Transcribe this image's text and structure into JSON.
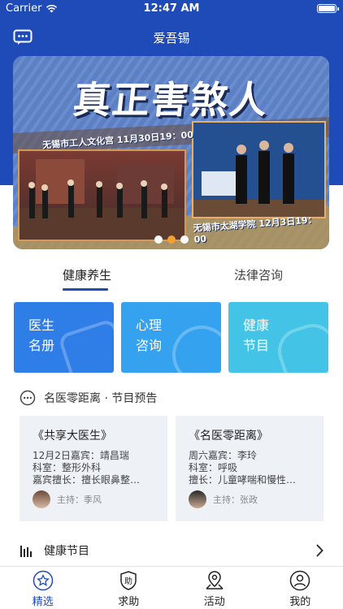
{
  "status_bar": {
    "carrier": "Carrier",
    "time": "12:47 AM"
  },
  "nav": {
    "title": "爱吾锡",
    "message_icon": "chat-bubble-icon"
  },
  "banner": {
    "title": "真正害煞人",
    "caption_1": "无锡市工人文化宫 11月30日19：00",
    "caption_2": "无锡市太湖学院 12月3日19：00",
    "page_count": 3,
    "active_page": 2
  },
  "tabs": [
    {
      "label": "健康养生",
      "active": true
    },
    {
      "label": "法律咨询",
      "active": false
    }
  ],
  "cards": [
    {
      "line1": "医生",
      "line2": "名册",
      "color": "#2f7ee8"
    },
    {
      "line1": "心理",
      "line2": "咨询",
      "color": "#35a2ef"
    },
    {
      "line1": "健康",
      "line2": "节目",
      "color": "#43c4e6"
    }
  ],
  "section": {
    "title": "名医零距离 · 节目预告"
  },
  "programs": [
    {
      "title": "《共享大医生》",
      "line1": "12月2日嘉宾：靖昌瑞",
      "line2": "科室：整形外科",
      "line3": "嘉宾擅长：擅长眼鼻整…",
      "host": "主持：季风"
    },
    {
      "title": "《名医零距离》",
      "line1": "周六嘉宾：李玲",
      "line2": "科室：呼吸",
      "line3": "擅长：儿童哮喘和慢性…",
      "host": "主持：张政"
    }
  ],
  "list_row": {
    "label": "健康节目"
  },
  "tabbar": [
    {
      "label": "精选",
      "icon": "star-icon",
      "active": true
    },
    {
      "label": "求助",
      "icon": "help-shield-icon",
      "active": false
    },
    {
      "label": "活动",
      "icon": "map-pin-icon",
      "active": false
    },
    {
      "label": "我的",
      "icon": "profile-icon",
      "active": false
    }
  ],
  "colors": {
    "primary": "#1f4bb8",
    "accent_dot": "#f3a130"
  }
}
